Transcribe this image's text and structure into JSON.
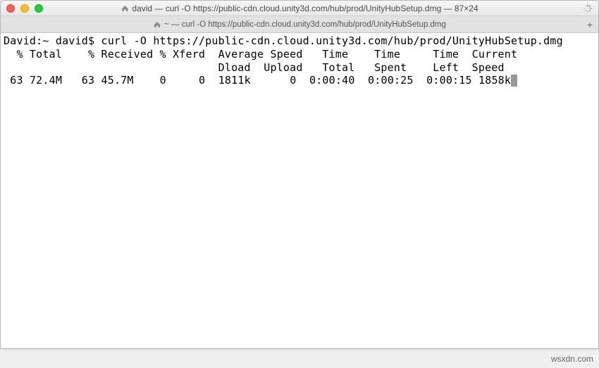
{
  "window": {
    "title_prefix": "david — curl -O https://public-cdn.cloud.unity3d.com/hub/prod/UnityHubSetup.dmg — 87×24"
  },
  "tab": {
    "label": "~ — curl -O https://public-cdn.cloud.unity3d.com/hub/prod/UnityHubSetup.dmg"
  },
  "prompt": {
    "host_user": "David:~ david$",
    "command": "curl -O https://public-cdn.cloud.unity3d.com/hub/prod/UnityHubSetup.dmg"
  },
  "curl_header": {
    "row1": "  % Total    % Received % Xferd  Average Speed   Time    Time     Time  Current",
    "row2": "                                 Dload  Upload   Total   Spent    Left  Speed"
  },
  "curl_progress": {
    "pct_total": "63",
    "total": "72.4M",
    "pct_recv": "63",
    "received": "45.7M",
    "pct_xferd": "0",
    "xferd": "0",
    "avg_dload": "1811k",
    "avg_upload": "0",
    "time_total": "0:00:40",
    "time_spent": "0:00:25",
    "time_left": "0:00:15",
    "current_speed": "1858k"
  },
  "watermark": "wsxdn.com"
}
